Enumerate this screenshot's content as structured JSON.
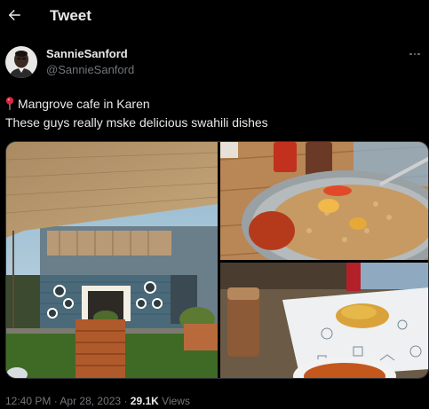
{
  "header": {
    "title": "Tweet",
    "back_icon": "arrow-left-icon"
  },
  "author": {
    "display_name": "SannieSanford",
    "handle": "@SannieSanford"
  },
  "tweet": {
    "line1": "Mangrove cafe in Karen",
    "line2": "These guys really mske delicious swahili dishes",
    "pin_icon": "round-pushpin-icon"
  },
  "media": [
    {
      "name": "cafe-exterior-photo"
    },
    {
      "name": "rice-dish-photo"
    },
    {
      "name": "tea-and-chapati-photo"
    }
  ],
  "meta": {
    "time": "12:40 PM",
    "sep1": "·",
    "date": "Apr 28, 2023",
    "sep2": "·",
    "views_count": "29.1K",
    "views_label": "Views"
  },
  "colors": {
    "background": "#000000",
    "text": "#e7e9ea",
    "secondary": "#71767b",
    "border": "#2f3336"
  }
}
